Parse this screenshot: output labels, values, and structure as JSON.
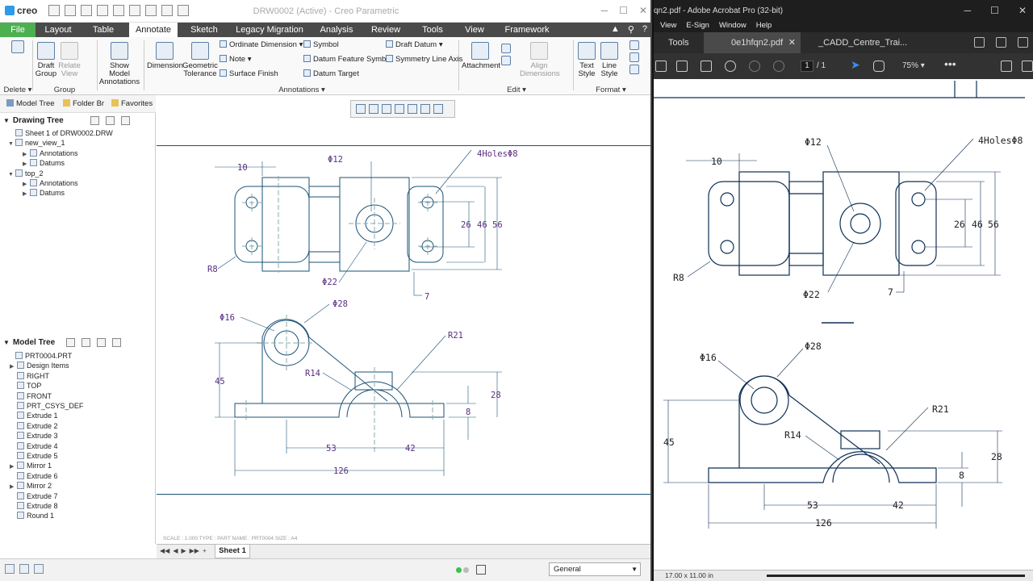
{
  "creo": {
    "logo": "creo",
    "window_title": "DRW0002 (Active) - Creo Parametric",
    "tabs": [
      "File",
      "Layout",
      "Table",
      "Annotate",
      "Sketch",
      "Legacy Migration",
      "Analysis",
      "Review",
      "Tools",
      "View",
      "Framework"
    ],
    "active_tab": "Annotate",
    "ribbon": {
      "delete": {
        "label": "Delete"
      },
      "draft_group": {
        "label": "Draft\nGroup"
      },
      "relate_view": {
        "label": "Relate\nView"
      },
      "group_label": "Group",
      "show_model_annotations": "Show Model\nAnnotations",
      "dimension": "Dimension",
      "geometric_tolerance": "Geometric\nTolerance",
      "ordinate_dimension": "Ordinate Dimension",
      "note": "Note",
      "surface_finish": "Surface Finish",
      "symbol": "Symbol",
      "datum_feature_symbol": "Datum Feature Symbol",
      "datum_target": "Datum Target",
      "draft_datum": "Draft Datum",
      "symmetry_line_axis": "Symmetry Line Axis",
      "annotations_label": "Annotations",
      "attachment": "Attachment",
      "align_dimensions": "Align\nDimensions",
      "edit_label": "Edit",
      "text_style": "Text\nStyle",
      "line_style": "Line\nStyle",
      "format_label": "Format"
    },
    "left_panel": {
      "tabs": [
        "Model Tree",
        "Folder Br",
        "Favorites"
      ],
      "drawing_tree_title": "Drawing Tree",
      "drawing_tree": [
        {
          "label": "Sheet 1 of DRW0002.DRW",
          "level": 0,
          "expand": ""
        },
        {
          "label": "new_view_1",
          "level": 0,
          "expand": "▼"
        },
        {
          "label": "Annotations",
          "level": 1,
          "expand": "▶"
        },
        {
          "label": "Datums",
          "level": 1,
          "expand": "▶"
        },
        {
          "label": "top_2",
          "level": 0,
          "expand": "▼"
        },
        {
          "label": "Annotations",
          "level": 1,
          "expand": "▶"
        },
        {
          "label": "Datums",
          "level": 1,
          "expand": "▶"
        }
      ],
      "model_tree_title": "Model Tree",
      "model_tree": [
        {
          "label": "PRT0004.PRT",
          "expand": ""
        },
        {
          "label": "Design Items",
          "expand": "▶"
        },
        {
          "label": "RIGHT",
          "expand": ""
        },
        {
          "label": "TOP",
          "expand": ""
        },
        {
          "label": "FRONT",
          "expand": ""
        },
        {
          "label": "PRT_CSYS_DEF",
          "expand": ""
        },
        {
          "label": "Extrude 1",
          "expand": ""
        },
        {
          "label": "Extrude 2",
          "expand": ""
        },
        {
          "label": "Extrude 3",
          "expand": ""
        },
        {
          "label": "Extrude 4",
          "expand": ""
        },
        {
          "label": "Extrude 5",
          "expand": ""
        },
        {
          "label": "Mirror 1",
          "expand": "▶"
        },
        {
          "label": "Extrude 6",
          "expand": ""
        },
        {
          "label": "Mirror 2",
          "expand": "▶"
        },
        {
          "label": "Extrude 7",
          "expand": ""
        },
        {
          "label": "Extrude 8",
          "expand": ""
        },
        {
          "label": "Round 1",
          "expand": ""
        }
      ]
    },
    "drawing": {
      "dims": {
        "d10": "10",
        "dia12": "Φ12",
        "holes": "4HolesΦ8",
        "d26": "26",
        "d46": "46",
        "d56": "56",
        "r8": "R8",
        "dia22": "Φ22",
        "d7": "7",
        "dia16": "Φ16",
        "dia28": "Φ28",
        "r21": "R21",
        "r14": "R14",
        "d45": "45",
        "d28": "28",
        "d8": "8",
        "d53": "53",
        "d42": "42",
        "d126": "126"
      },
      "status_line": "SCALE : 1.000    TYPE : PART    NAME : PRT0004    SIZE : A4"
    },
    "sheet_tab": "Sheet 1",
    "filter_value": "General"
  },
  "acrobat": {
    "title": "qn2.pdf - Adobe Acrobat Pro (32-bit)",
    "menu": [
      "View",
      "E-Sign",
      "Window",
      "Help"
    ],
    "tabs": {
      "tools": "Tools",
      "doc1": "0e1hfqn2.pdf",
      "doc2": "_CADD_Centre_Trai..."
    },
    "page_current": "1",
    "page_total": "/ 1",
    "zoom": "75%",
    "page_size": "17.00 x 11.00 in"
  }
}
